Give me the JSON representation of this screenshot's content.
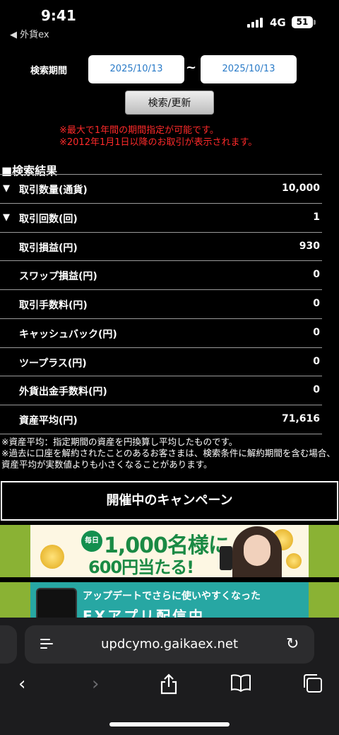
{
  "status_bar": {
    "time": "9:41",
    "back_app": "◀ 外貨ex",
    "network": "4G",
    "battery": "51"
  },
  "search": {
    "period_label": "検索期間",
    "date_from": "2025/10/13",
    "date_to": "2025/10/13",
    "separator": "~",
    "button_label": "検索/更新",
    "notice_1": "※最大で1年間の期間指定が可能です。",
    "notice_2": "※2012年1月1日以降のお取引が表示されます。"
  },
  "results": {
    "title": "■検索結果",
    "rows": [
      {
        "arrow": "▼",
        "label": "取引数量(通貨)",
        "value": "10,000"
      },
      {
        "arrow": "▼",
        "label": "取引回数(回)",
        "value": "1"
      },
      {
        "arrow": "",
        "label": "取引損益(円)",
        "value": "930"
      },
      {
        "arrow": "",
        "label": "スワップ損益(円)",
        "value": "0"
      },
      {
        "arrow": "",
        "label": "取引手数料(円)",
        "value": "0"
      },
      {
        "arrow": "",
        "label": "キャッシュバック(円)",
        "value": "0"
      },
      {
        "arrow": "",
        "label": "ツープラス(円)",
        "value": "0"
      },
      {
        "arrow": "",
        "label": "外貨出金手数料(円)",
        "value": "0"
      },
      {
        "arrow": "",
        "label": "資産平均(円)",
        "value": "71,616"
      }
    ],
    "footnote_1": "※資産平均：指定期間の資産を円換算し平均したものです。",
    "footnote_2": "※過去に口座を解約されたことのあるお客さまは、検索条件に解約期間を含む場合、資産平均が実数値よりも小さくなることがあります。"
  },
  "campaign": {
    "title": "開催中のキャンペーン",
    "banner_1": {
      "daily": "毎日",
      "line_1": "1,000名様に",
      "line_2": "600円当たる!"
    },
    "banner_2": {
      "line_1": "アップデートでさらに使いやすくなった",
      "line_2": "EXアプリ配信中"
    }
  },
  "browser": {
    "url": "updcymo.gaikaex.net"
  }
}
